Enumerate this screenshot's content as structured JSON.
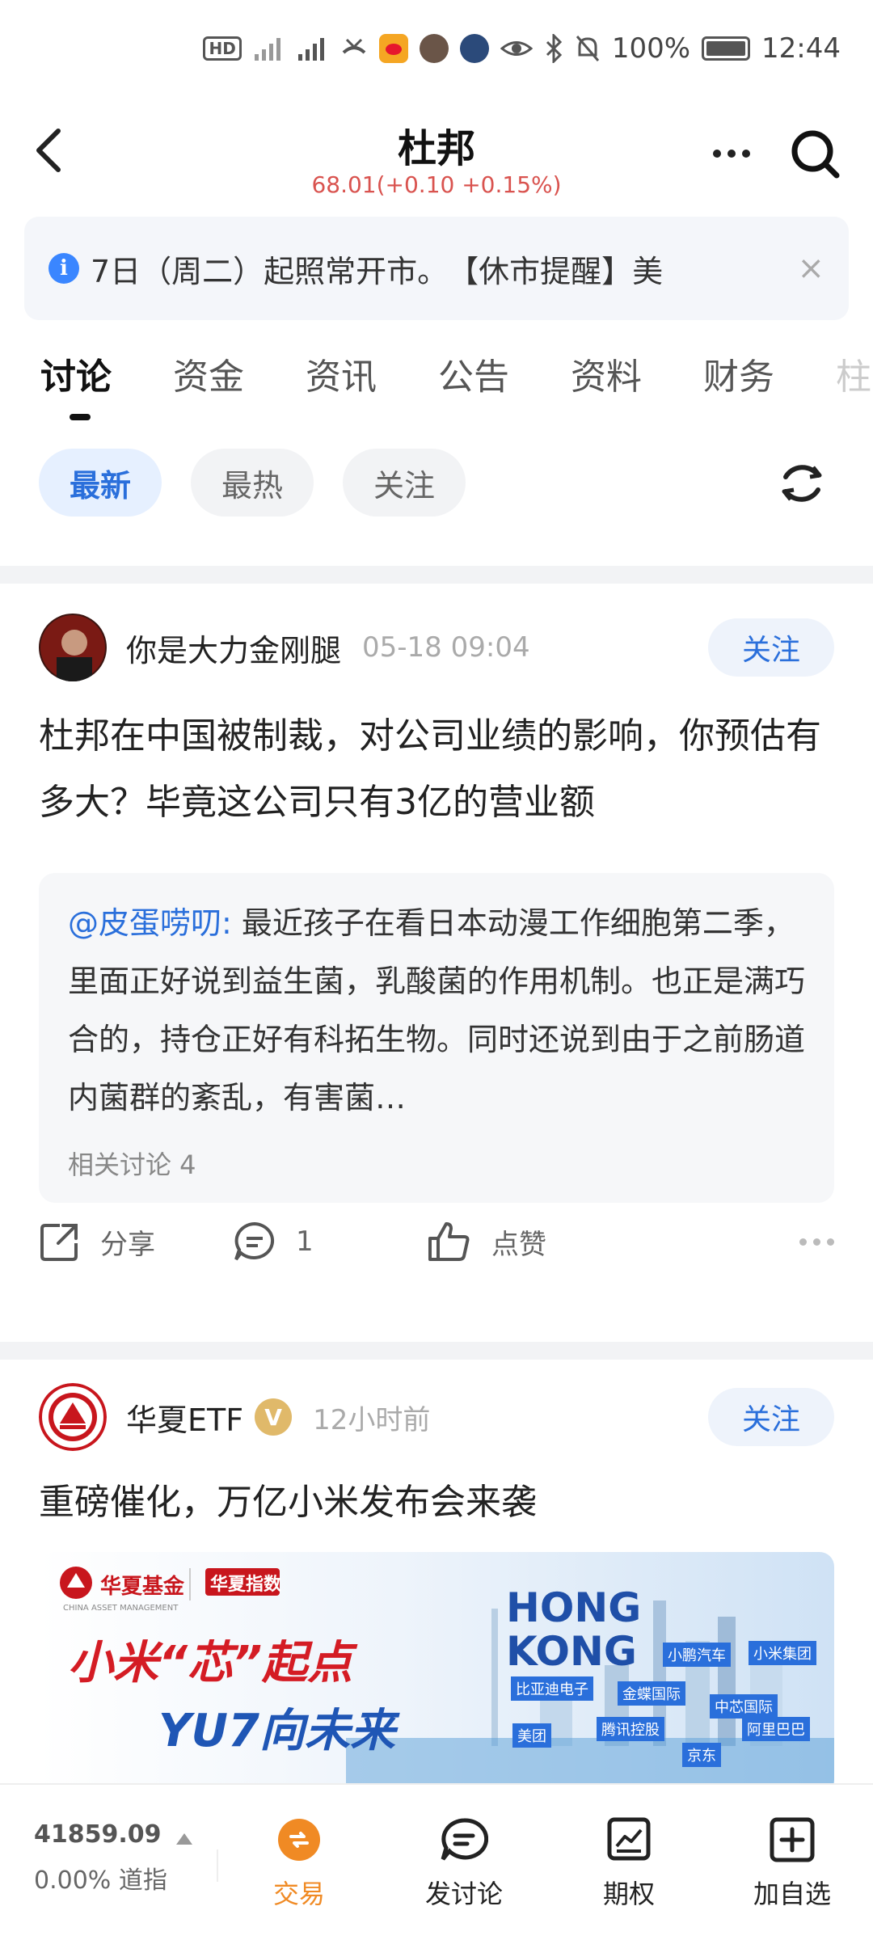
{
  "status_bar": {
    "battery_text": "100%",
    "time": "12:44"
  },
  "header": {
    "title": "杜邦",
    "price_change": "68.01(+0.10 +0.15%)"
  },
  "notice": {
    "text": "7日（周二）起照常开市。　【休市提醒】美"
  },
  "tabs": [
    "讨论",
    "资金",
    "资讯",
    "公告",
    "资料",
    "财务",
    "柱"
  ],
  "filters": [
    "最新",
    "最热",
    "关注"
  ],
  "posts": [
    {
      "author": "你是大力金刚腿",
      "time": "05-18 09:04",
      "follow_label": "关注",
      "body": "杜邦在中国被制裁，对公司业绩的影响，你预估有多大？毕竟这公司只有3亿的营业额",
      "quote": {
        "mention": "@皮蛋唠叨:",
        "text": " 最近孩子在看日本动漫工作细胞第二季，里面正好说到益生菌，乳酸菌的作用机制。也正是满巧合的，持仓正好有科拓生物。同时还说到由于之前肠道内菌群的紊乱，有害菌…",
        "related": "相关讨论 4"
      },
      "actions": {
        "share": "分享",
        "comments": "1",
        "like": "点赞"
      }
    },
    {
      "author": "华夏ETF",
      "badge": "V",
      "time": "12小时前",
      "follow_label": "关注",
      "body": "重磅催化，万亿小米发布会来袭",
      "banner": {
        "brand": "华夏基金",
        "brand_sub": "CHINA ASSET MANAGEMENT",
        "brand_tag": "华夏指数",
        "headline_1": "小米“芯”起点",
        "headline_2": "YU7向未来",
        "city_1": "HONG",
        "city_2": "KONG",
        "tags": [
          "小鹏汽车",
          "小米集团",
          "比亚迪电子",
          "金蝶国际",
          "中芯国际",
          "美团",
          "腾讯控股",
          "阿里巴巴",
          "京东"
        ]
      }
    }
  ],
  "bottom_nav": {
    "index_value": "41859.09",
    "index_sub": "0.00% 道指",
    "items": [
      "交易",
      "发讨论",
      "期权",
      "加自选"
    ]
  },
  "colors": {
    "accent_blue": "#2a6fdb",
    "up_red": "#d9534f",
    "trade_orange": "#f08a24"
  }
}
